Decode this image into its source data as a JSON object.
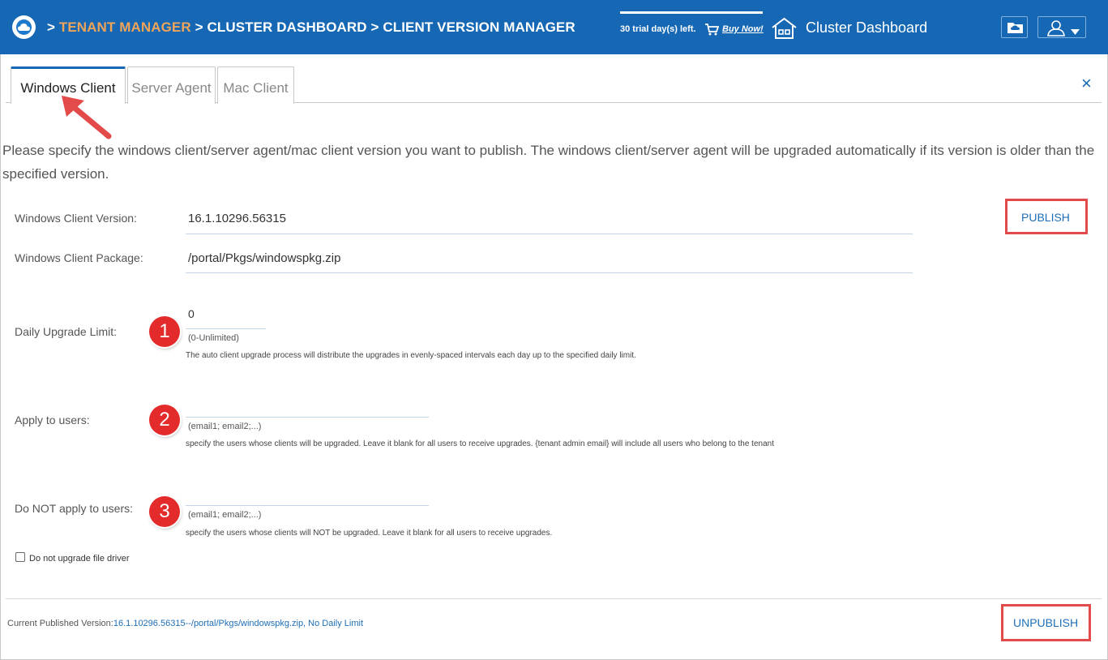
{
  "header": {
    "breadcrumb": {
      "sep": ">",
      "item1": "TENANT MANAGER",
      "item2": "CLUSTER DASHBOARD",
      "item3": "CLIENT VERSION MANAGER"
    },
    "trial_text": "30 trial day(s) left.",
    "buy_now": "Buy Now!",
    "cluster_dashboard": "Cluster Dashboard",
    "colors": {
      "bar": "#1668b4",
      "breadcrumb_accent": "#f0a45a"
    },
    "icons": [
      "cloud-logo-icon",
      "cart-icon",
      "house-icon",
      "folder-icon",
      "user-icon",
      "chevron-down-icon"
    ]
  },
  "tabs": [
    {
      "label": "Windows Client",
      "active": true
    },
    {
      "label": "Server Agent",
      "active": false
    },
    {
      "label": "Mac Client",
      "active": false
    }
  ],
  "close_icon": "×",
  "description": "Please specify the windows client/server agent/mac client version you want to publish. The windows client/server agent will be upgraded automatically if its version is older than the specified version.",
  "form": {
    "version": {
      "label": "Windows Client Version:",
      "value": "16.1.10296.56315"
    },
    "package": {
      "label": "Windows Client Package:",
      "value": "/portal/Pkgs/windowspkg.zip"
    },
    "daily_limit": {
      "label": "Daily Upgrade Limit:",
      "value": "0",
      "hint": "(0-Unlimited)",
      "help": "The auto client upgrade process will distribute the upgrades in evenly-spaced intervals each day up to the specified daily limit."
    },
    "apply_users": {
      "label": "Apply to users:",
      "value": "",
      "hint": "(email1; email2;...)",
      "help": "specify the users whose clients will be upgraded. Leave it blank for all users to receive upgrades. {tenant admin email} will include all users who belong to the tenant"
    },
    "exclude_users": {
      "label": "Do NOT apply to users:",
      "value": "",
      "hint": "(email1; email2;...)",
      "help": "specify the users whose clients will NOT be upgraded. Leave it blank for all users to receive upgrades."
    },
    "no_upgrade_driver": {
      "label": "Do not upgrade file driver",
      "checked": false
    }
  },
  "actions": {
    "publish": "PUBLISH",
    "unpublish": "UNPUBLISH"
  },
  "annotations": {
    "badge1": "1",
    "badge2": "2",
    "badge3": "3",
    "highlight_color": "#e34b4b"
  },
  "footer": {
    "label": "Current Published Version:",
    "value": "16.1.10296.56315--/portal/Pkgs/windowspkg.zip, No Daily Limit"
  }
}
